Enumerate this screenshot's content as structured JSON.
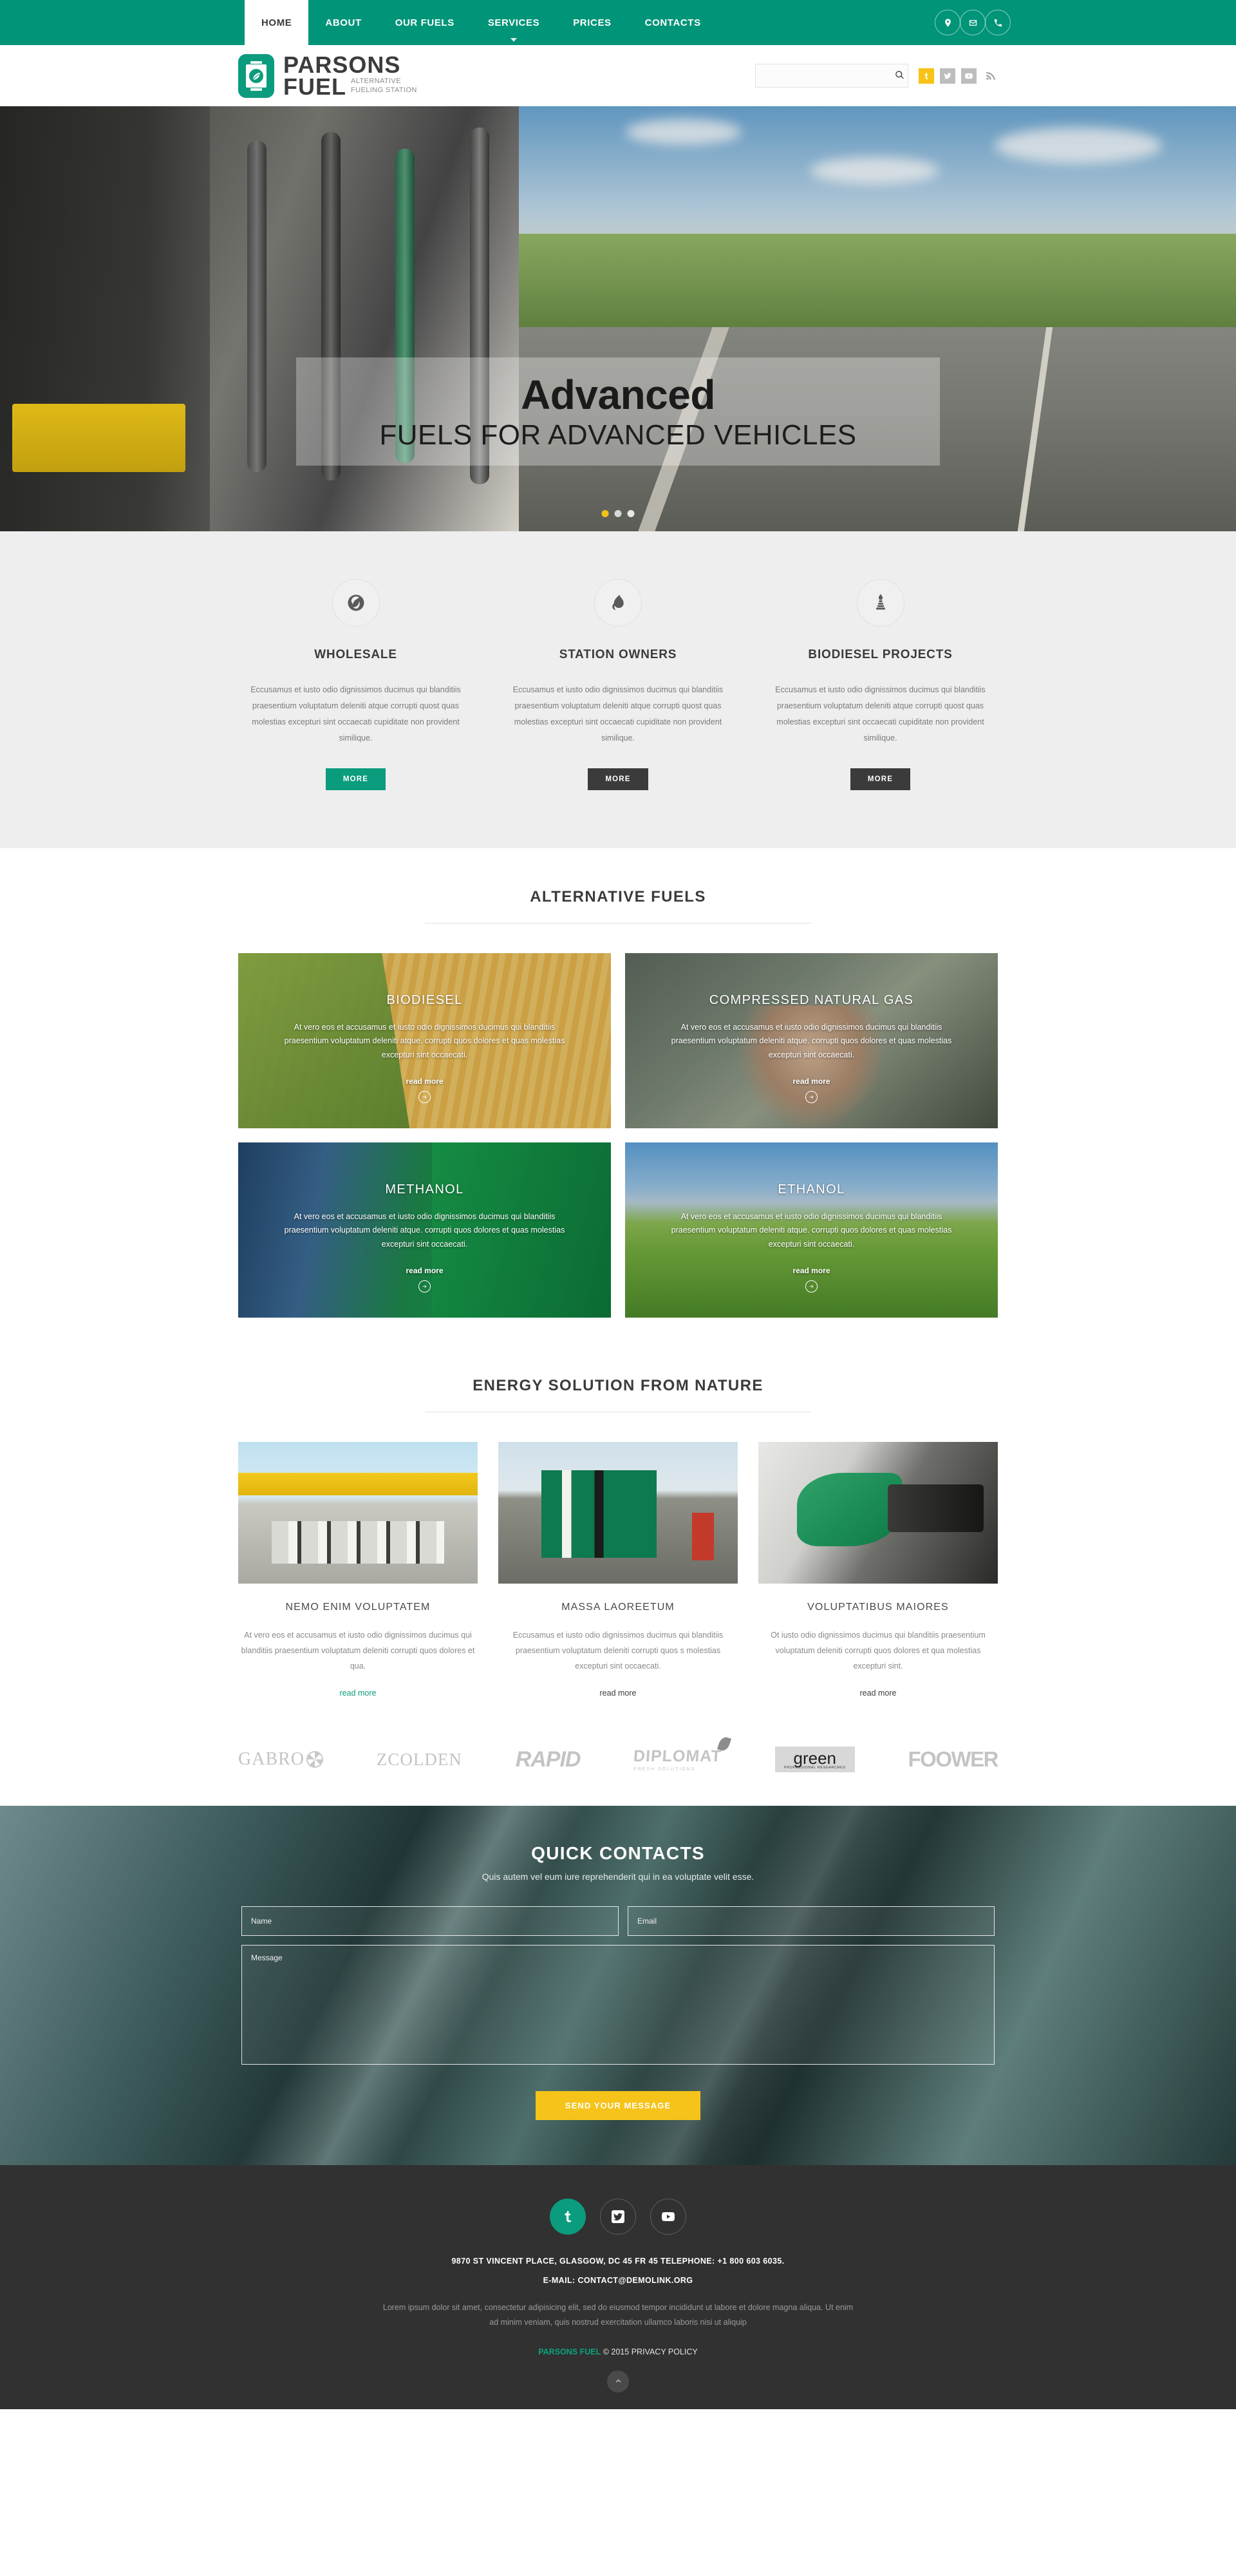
{
  "topnav": {
    "items": [
      {
        "label": "HOME",
        "active": true,
        "caret": false
      },
      {
        "label": "ABOUT",
        "active": false,
        "caret": false
      },
      {
        "label": "OUR FUELS",
        "active": false,
        "caret": false
      },
      {
        "label": "SERVICES",
        "active": false,
        "caret": true
      },
      {
        "label": "PRICES",
        "active": false,
        "caret": false
      },
      {
        "label": "CONTACTS",
        "active": false,
        "caret": false
      }
    ],
    "quick_icons": [
      "location-pin-icon",
      "envelope-icon",
      "phone-icon"
    ]
  },
  "header": {
    "logo": {
      "line1": "PARSONS",
      "line2": "FUEL",
      "tagline_line1": "ALTERNATIVE",
      "tagline_line2": "FUELING STATION",
      "mark_icon": "oil-barrel-leaf-icon",
      "mark_color": "#0a9c7d"
    },
    "search": {
      "value": "",
      "placeholder": "",
      "icon": "search-icon"
    },
    "socials": [
      {
        "name": "tumblr-icon",
        "label": "Tumblr",
        "color": "#f8c217"
      },
      {
        "name": "twitter-icon",
        "label": "Twitter",
        "color": "#bdbdbd"
      },
      {
        "name": "youtube-icon",
        "label": "YouTube",
        "color": "#bdbdbd"
      },
      {
        "name": "rss-icon",
        "label": "RSS",
        "color": "#9e9e9e"
      }
    ]
  },
  "hero": {
    "headline": "Advanced",
    "subhead": "FUELS FOR ADVANCED VEHICLES",
    "slides": 3,
    "active_slide": 1
  },
  "services": {
    "items": [
      {
        "icon": "globe-leaf-icon",
        "title": "WHOLESALE",
        "text": "Eccusamus et iusto odio dignissimos ducimus qui blanditiis praesentium voluptatum deleniti atque corrupti quost quas molestias excepturi sint occaecati cupiditate non provident similique.",
        "button": "MORE",
        "button_style": "green"
      },
      {
        "icon": "flame-drop-icon",
        "title": "STATION OWNERS",
        "text": "Eccusamus et iusto odio dignissimos ducimus qui blanditiis praesentium voluptatum deleniti atque corrupti quost quas molestias excepturi sint occaecati cupiditate non provident similique.",
        "button": "MORE",
        "button_style": "dark"
      },
      {
        "icon": "refinery-flame-icon",
        "title": "BIODIESEL PROJECTS",
        "text": "Eccusamus et iusto odio dignissimos ducimus qui blanditiis praesentium voluptatum deleniti atque corrupti quost quas molestias excepturi sint occaecati cupiditate non provident similique.",
        "button": "MORE",
        "button_style": "dark"
      }
    ]
  },
  "fuels_section": {
    "title": "ALTERNATIVE FUELS",
    "cards": [
      {
        "title": "BIODIESEL",
        "text": "At vero eos et accusamus et iusto odio dignissimos ducimus qui blanditiis praesentium voluptatum deleniti atque. corrupti quos dolores et quas molestias excepturi sint occaecati.",
        "more": "read more",
        "bg": "corn"
      },
      {
        "title": "COMPRESSED NATURAL GAS",
        "text": "At vero eos et accusamus et iusto odio dignissimos ducimus qui blanditiis praesentium voluptatum deleniti atque. corrupti quos dolores et quas molestias excepturi sint occaecati.",
        "more": "read more",
        "bg": "cng"
      },
      {
        "title": "METHANOL",
        "text": "At vero eos et accusamus et iusto odio dignissimos ducimus qui blanditiis praesentium voluptatum deleniti atque. corrupti quos dolores et quas molestias excepturi sint occaecati.",
        "more": "read more",
        "bg": "methanol"
      },
      {
        "title": "ETHANOL",
        "text": "At vero eos et accusamus et iusto odio dignissimos ducimus qui blanditiis praesentium voluptatum deleniti atque. corrupti quos dolores et quas molestias excepturi sint occaecati.",
        "more": "read more",
        "bg": "ethanol"
      }
    ]
  },
  "energy_section": {
    "title": "ENERGY SOLUTION FROM NATURE",
    "items": [
      {
        "image": "fuel-station-canopy-photo",
        "title": "NEMO ENIM VOLUPTATEM",
        "text": "At vero eos et accusamus et iusto odio dignissimos ducimus qui blanditiis praesentium voluptatum deleniti corrupti quos dolores et qua.",
        "more": "read more",
        "more_highlight": true
      },
      {
        "image": "green-fuel-pumps-photo",
        "title": "MASSA LAOREETUM",
        "text": "Eccusamus et iusto odio dignissimos ducimus qui blanditiis praesentium voluptatum deleniti corrupti quos s molestias excepturi sint occaecati.",
        "more": "read more",
        "more_highlight": false
      },
      {
        "image": "green-nozzle-photo",
        "title": "VOLUPTATIBUS MAIORES",
        "text": "Ot iusto odio dignissimos ducimus qui blanditiis praesentium voluptatum deleniti corrupti quos dolores et qua molestias excepturi sint.",
        "more": "read more",
        "more_highlight": false
      }
    ]
  },
  "brands": [
    {
      "name": "GABRO",
      "kind": "gabro"
    },
    {
      "name": "ZCOLDEN",
      "kind": "zcolden"
    },
    {
      "name": "RAPID",
      "kind": "rapid"
    },
    {
      "name": "DIPLOMAT",
      "sub": "FRESH SOLUTIONS",
      "kind": "diplomat"
    },
    {
      "name": "green",
      "sub": "PROFESSIONAL RESEARCHES",
      "kind": "green"
    },
    {
      "name": "FOOWER",
      "kind": "foower"
    }
  ],
  "quick_contacts": {
    "title": "QUICK CONTACTS",
    "subtitle": "Quis autem vel eum iure reprehenderit qui in ea voluptate velit esse.",
    "name_placeholder": "Name",
    "name_value": "",
    "email_placeholder": "Email",
    "email_value": "",
    "message_placeholder": "Message",
    "message_value": "",
    "submit_label": "SEND YOUR MESSAGE",
    "submit_color": "#f5c31a"
  },
  "footer": {
    "socials": [
      {
        "name": "tumblr-icon",
        "active": true
      },
      {
        "name": "twitter-icon",
        "active": false
      },
      {
        "name": "youtube-icon",
        "active": false
      }
    ],
    "address": "9870 ST VINCENT PLACE,  GLASGOW, DC 45 FR 45   TELEPHONE:  +1 800 603 6035.",
    "email": "E-MAIL: CONTACT@DEMOLINK.ORG",
    "lorem": "Lorem ipsum dolor sit amet, consectetur adipisicing elit, sed do eiusmod tempor incididunt ut labore et dolore magna aliqua. Ut enim ad minim veniam, quis nostrud exercitation ullamco laboris nisi ut aliquip",
    "copy_brand": "PARSONS FUEL",
    "copy_rest": "© 2015",
    "privacy": "PRIVACY POLICY",
    "to_top_icon": "chevron-up-icon"
  },
  "theme": {
    "green": "#009478",
    "green_dark": "#0a9c7d",
    "yellow": "#f5c31a",
    "dark": "#313131",
    "grey_bg": "#eeeeee"
  }
}
